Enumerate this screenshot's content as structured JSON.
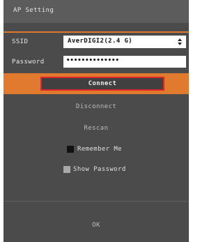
{
  "dialog": {
    "title": "AP Setting"
  },
  "form": {
    "ssid_label": "SSID",
    "ssid_value": "AverDIGI2(2.4 G)",
    "password_label": "Password",
    "password_value": "••••••••••••••"
  },
  "actions": {
    "connect": "Connect",
    "disconnect": "Disconnect",
    "rescan": "Rescan",
    "ok": "OK"
  },
  "options": {
    "remember_me": {
      "label": "Remember Me",
      "checked": false
    },
    "show_password": {
      "label": "Show Password",
      "checked": false
    }
  },
  "colors": {
    "accent_orange": "#e07a2e",
    "focus_red": "#e0242b",
    "panel_bg": "#4b4b4b"
  }
}
